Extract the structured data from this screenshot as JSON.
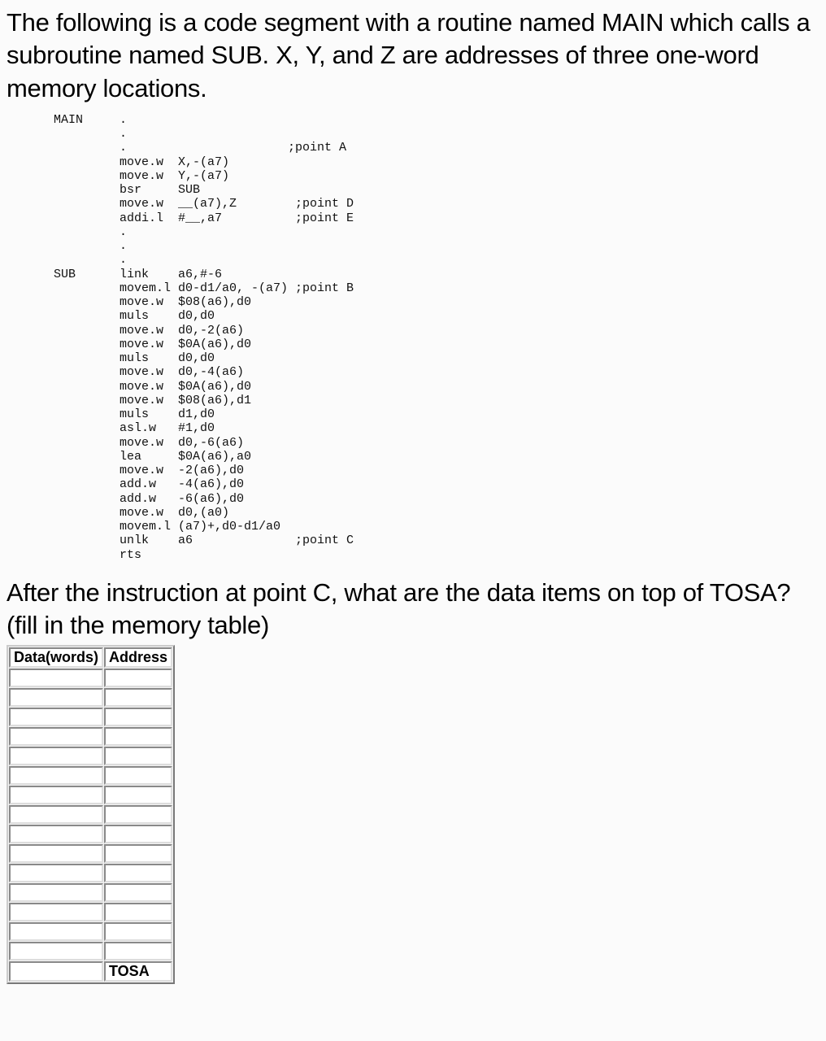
{
  "heading": "The following is a code segment with a routine named MAIN which calls a subroutine named SUB. X, Y, and Z are addresses of three one-word memory locations.",
  "code": "MAIN     .\n         .\n         .                      ;point A\n         move.w  X,-(a7)\n         move.w  Y,-(a7)\n         bsr     SUB\n         move.w  __(a7),Z        ;point D\n         addi.l  #__,a7          ;point E\n         .\n         .\n         .\nSUB      link    a6,#-6\n         movem.l d0-d1/a0, -(a7) ;point B\n         move.w  $08(a6),d0\n         muls    d0,d0\n         move.w  d0,-2(a6)\n         move.w  $0A(a6),d0\n         muls    d0,d0\n         move.w  d0,-4(a6)\n         move.w  $0A(a6),d0\n         move.w  $08(a6),d1\n         muls    d1,d0\n         asl.w   #1,d0\n         move.w  d0,-6(a6)\n         lea     $0A(a6),a0\n         move.w  -2(a6),d0\n         add.w   -4(a6),d0\n         add.w   -6(a6),d0\n         move.w  d0,(a0)\n         movem.l (a7)+,d0-d1/a0\n         unlk    a6              ;point C\n         rts",
  "question": "After the instruction at point C, what are the data items on top of TOSA? (fill in the memory table)",
  "table": {
    "col1": "Data(words)",
    "col2": "Address",
    "rows": [
      {
        "data": "",
        "addr": ""
      },
      {
        "data": "",
        "addr": ""
      },
      {
        "data": "",
        "addr": ""
      },
      {
        "data": "",
        "addr": ""
      },
      {
        "data": "",
        "addr": ""
      },
      {
        "data": "",
        "addr": ""
      },
      {
        "data": "",
        "addr": ""
      },
      {
        "data": "",
        "addr": ""
      },
      {
        "data": "",
        "addr": ""
      },
      {
        "data": "",
        "addr": ""
      },
      {
        "data": "",
        "addr": ""
      },
      {
        "data": "",
        "addr": ""
      },
      {
        "data": "",
        "addr": ""
      },
      {
        "data": "",
        "addr": ""
      },
      {
        "data": "",
        "addr": ""
      },
      {
        "data": "",
        "addr": "TOSA"
      }
    ]
  }
}
